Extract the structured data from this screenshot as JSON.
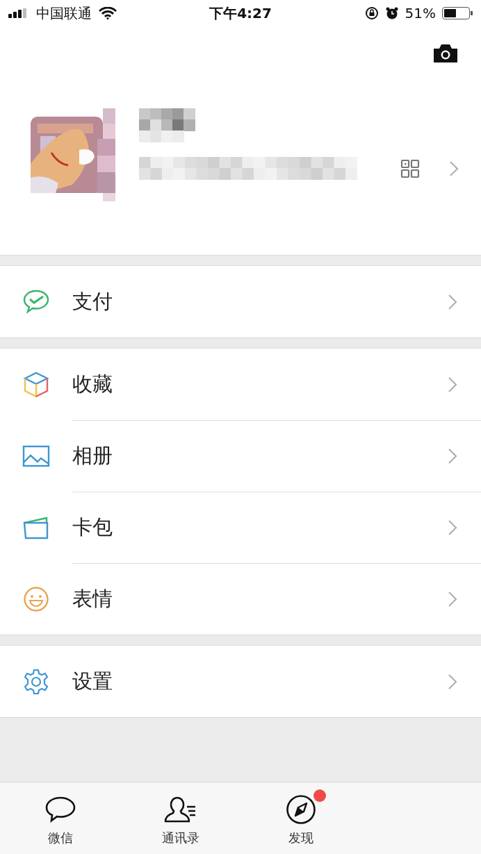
{
  "status_bar": {
    "carrier": "中国联通",
    "time": "下午4:27",
    "battery": "51%"
  },
  "groups": [
    {
      "items": [
        {
          "label": "支付",
          "kind": "pay"
        }
      ]
    },
    {
      "items": [
        {
          "label": "收藏",
          "kind": "favorites"
        },
        {
          "label": "相册",
          "kind": "album"
        },
        {
          "label": "卡包",
          "kind": "cards"
        },
        {
          "label": "表情",
          "kind": "stickers"
        }
      ]
    },
    {
      "items": [
        {
          "label": "设置",
          "kind": "settings"
        }
      ]
    }
  ],
  "tab_bar": [
    {
      "label": "微信",
      "kind": "chat",
      "selected": false,
      "badge": false
    },
    {
      "label": "通讯录",
      "kind": "contacts",
      "selected": false,
      "badge": false
    },
    {
      "label": "发现",
      "kind": "discover",
      "selected": false,
      "badge": true
    }
  ]
}
